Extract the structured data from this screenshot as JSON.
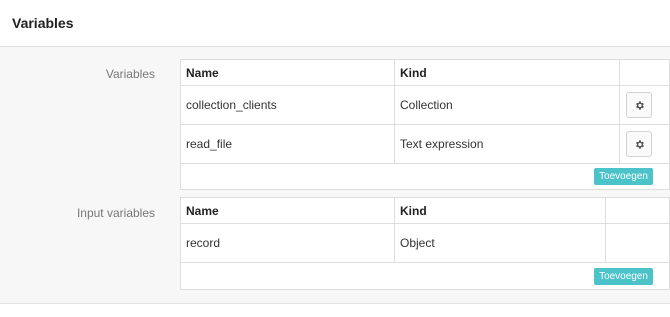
{
  "panel": {
    "title": "Variables"
  },
  "variables": {
    "label": "Variables",
    "headers": {
      "name": "Name",
      "kind": "Kind"
    },
    "rows": [
      {
        "name": "collection_clients",
        "kind": "Collection",
        "action_icon": "gear-icon"
      },
      {
        "name": "read_file",
        "kind": "Text expression",
        "action_icon": "gear-icon"
      }
    ],
    "add_label": "Toevoegen"
  },
  "input_variables": {
    "label": "Input variables",
    "headers": {
      "name": "Name",
      "kind": "Kind"
    },
    "rows": [
      {
        "name": "record",
        "kind": "Object"
      }
    ],
    "add_label": "Toevoegen"
  },
  "colors": {
    "accent": "#4cc3c9",
    "border": "#dedede",
    "panel_bg": "#f7f7f7"
  }
}
